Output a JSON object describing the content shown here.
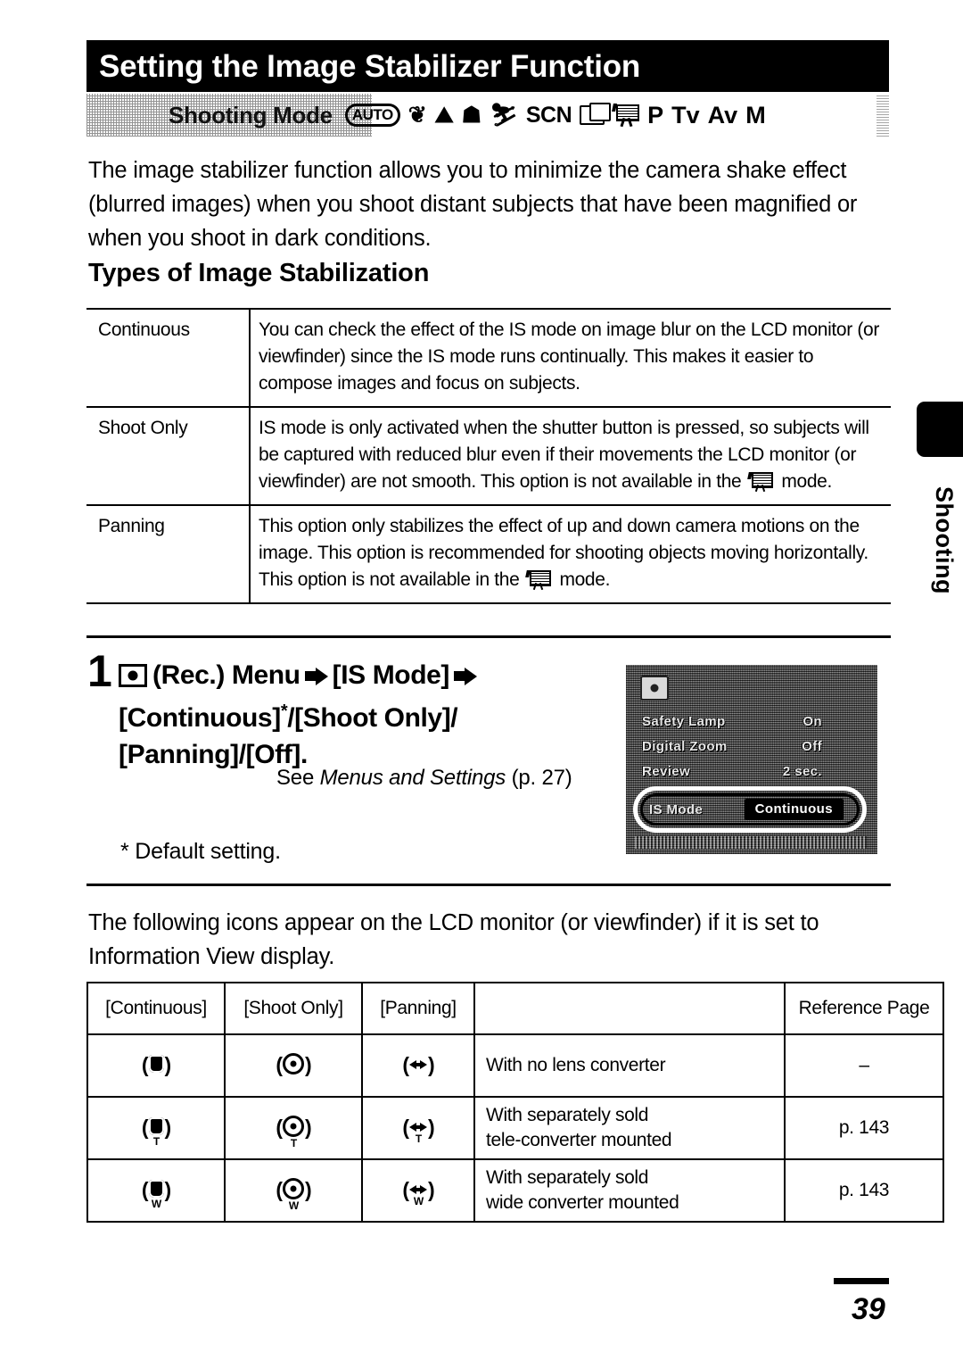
{
  "page": {
    "title": "Setting the Image Stabilizer Function",
    "page_number": "39",
    "side_tab_label": "Shooting"
  },
  "shooting_mode": {
    "label": "Shooting Mode",
    "icons": [
      {
        "name": "auto-mode-icon",
        "text": "AUTO"
      },
      {
        "name": "portrait-mode-icon",
        "text": "❦"
      },
      {
        "name": "landscape-mode-icon",
        "text": "⛰"
      },
      {
        "name": "night-scene-mode-icon",
        "text": "☗"
      },
      {
        "name": "sports-mode-icon",
        "text": "⛷"
      },
      {
        "name": "scn-mode-icon",
        "text": "SCN"
      },
      {
        "name": "stitch-assist-mode-icon",
        "text": ""
      },
      {
        "name": "movie-mode-icon",
        "text": ""
      },
      {
        "name": "program-mode-icon",
        "text": "P"
      },
      {
        "name": "tv-mode-icon",
        "text": "Tv"
      },
      {
        "name": "av-mode-icon",
        "text": "Av"
      },
      {
        "name": "manual-mode-icon",
        "text": "M"
      }
    ]
  },
  "intro_paragraph": "The image stabilizer function allows you to minimize the camera shake effect (blurred images) when you shoot distant subjects that have been magnified or when you shoot in dark conditions.",
  "section_heading": "Types of Image Stabilization",
  "types_table": {
    "rows": [
      {
        "name": "Continuous",
        "description": "You can check the effect of the IS mode on image blur on the LCD monitor (or viewfinder) since the IS mode runs continually. This makes it easier to compose images and focus on subjects."
      },
      {
        "name": "Shoot Only",
        "desc_part1": "IS mode is only activated when the shutter button is pressed, so subjects will be captured with reduced blur even if their movements the LCD monitor (or viewfinder) are not smooth. This option is not available in the",
        "desc_part2": "mode."
      },
      {
        "name": "Panning",
        "desc_part1": "This option only stabilizes the effect of up and down camera motions on the image. This option is recommended for shooting objects moving horizontally. This option is not available in the",
        "desc_part2": "mode."
      }
    ]
  },
  "step": {
    "number": "1",
    "line1_a": "(Rec.) Menu",
    "line1_b": "[IS Mode]",
    "line2": "[Continuous]",
    "line2_star": "*",
    "line2_rest": "/[Shoot Only]/",
    "line3": "[Panning]/[Off].",
    "see_prefix": "See ",
    "see_italic": "Menus and Settings",
    "see_suffix": " (p. 27)",
    "default_note": "* Default setting."
  },
  "lcd": {
    "rows": [
      {
        "label": "Safety Lamp",
        "value": "On"
      },
      {
        "label": "Digital Zoom",
        "value": "Off"
      },
      {
        "label": "Review",
        "value": "2 sec."
      }
    ],
    "selected": {
      "label": "IS Mode",
      "value": "Continuous"
    }
  },
  "icons_paragraph": "The following icons appear on the LCD monitor (or viewfinder) if it is set to Information View display.",
  "icons_table": {
    "headers": [
      "[Continuous]",
      "[Shoot Only]",
      "[Panning]",
      "",
      "Reference Page"
    ],
    "rows": [
      {
        "description": "With no lens converter",
        "reference": "–",
        "sub": ""
      },
      {
        "description_line1": "With separately sold",
        "description_line2": "tele-converter mounted",
        "reference": "p. 143",
        "sub": "T"
      },
      {
        "description_line1": "With separately sold",
        "description_line2": "wide converter mounted",
        "reference": "p. 143",
        "sub": "W"
      }
    ]
  }
}
